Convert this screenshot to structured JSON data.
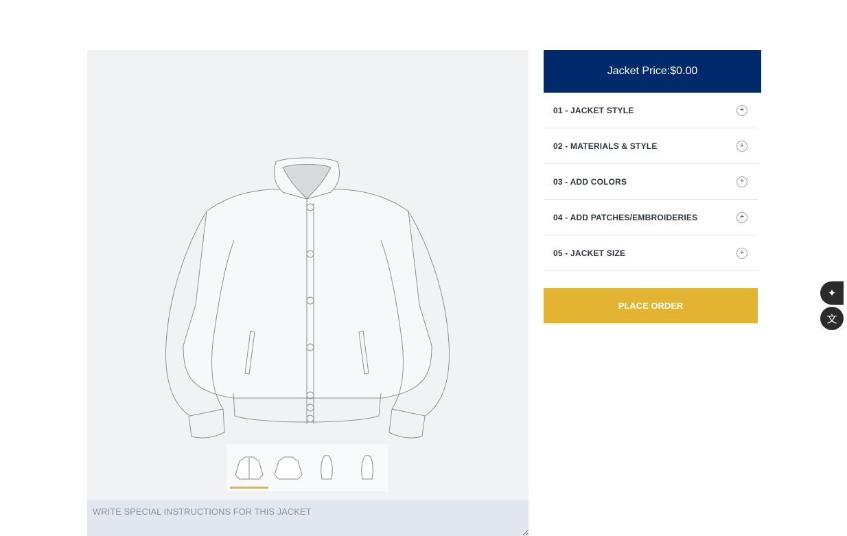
{
  "price": {
    "label": "Jacket Price:$0.00"
  },
  "accordion": [
    {
      "label": "01 - JACKET STYLE",
      "icon": "plus-icon"
    },
    {
      "label": "02 - MATERIALS & STYLE",
      "icon": "plus-icon"
    },
    {
      "label": "03 - ADD COLORS",
      "icon": "plus-icon"
    },
    {
      "label": "04 - ADD PATCHES/EMBROIDERIES",
      "icon": "plus-icon"
    },
    {
      "label": "05 - JACKET SIZE",
      "icon": "plus-icon"
    }
  ],
  "place_order": {
    "label": "PLACE ORDER"
  },
  "instructions": {
    "placeholder": "WRITE SPECIAL INSTRUCTIONS FOR THIS JACKET"
  },
  "thumbnails": [
    {
      "view": "front",
      "active": true
    },
    {
      "view": "back",
      "active": false
    },
    {
      "view": "left-side",
      "active": false
    },
    {
      "view": "right-side",
      "active": false
    }
  ],
  "colors": {
    "price_bg": "#002a6c",
    "accent": "#e2b432",
    "preview_bg": "#f1f2f4",
    "textarea_bg": "#e2e7ef"
  },
  "floating": {
    "ai_icon": "sparkle-icon",
    "translate_icon": "translate-icon"
  }
}
